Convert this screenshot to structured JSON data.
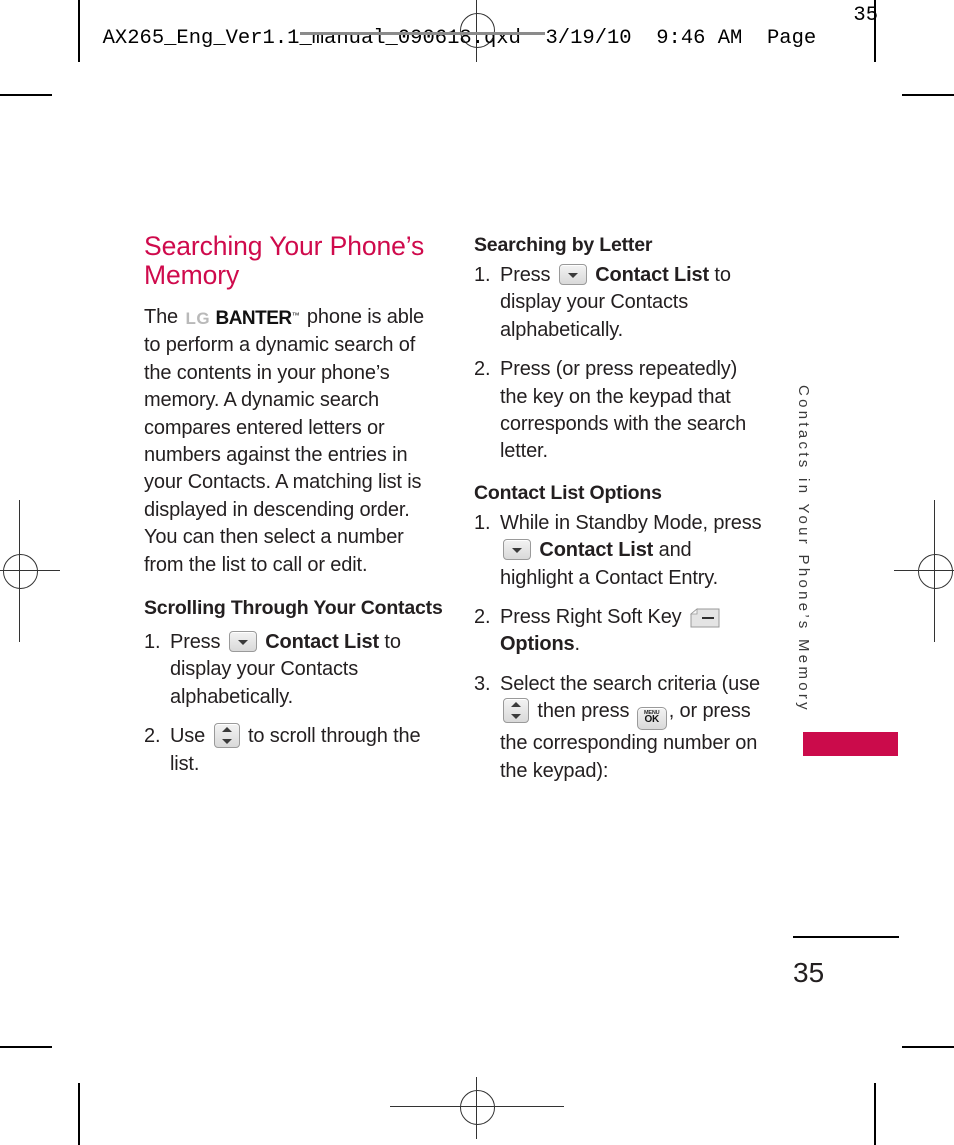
{
  "slug": {
    "filename": "AX265_Eng_Ver1.1_manual_090618.qxd",
    "date": "3/19/10",
    "time": "9:46 AM",
    "page_label": "Page",
    "page_value": "35"
  },
  "left_column": {
    "heading": "Searching Your Phone’s Memory",
    "paragraph_before_logo": "The",
    "logo": {
      "lg": "LG",
      "banter": "BANTER",
      "tm": "™"
    },
    "paragraph_after_logo": "phone is able to perform a dynamic search of the contents in your phone’s memory. A dynamic search compares entered letters or numbers against the entries in your Contacts. A matching list is displayed in descending order. You can then select a number from the list to call or edit.",
    "subheading": "Scrolling Through Your Contacts",
    "steps": [
      {
        "num": "1.",
        "before": "Press",
        "icon": "down-key-icon",
        "bold": "Contact List",
        "after": "to display your Contacts alphabetically."
      },
      {
        "num": "2.",
        "before": "Use",
        "icon": "scroll-key-icon",
        "bold": "",
        "after": "to scroll through the list."
      }
    ]
  },
  "right_column": {
    "heading_letter": "Searching by Letter",
    "letter_steps": [
      {
        "num": "1.",
        "before": "Press",
        "icon": "down-key-icon",
        "bold": "Contact List",
        "after": "to display your Contacts alphabetically."
      },
      {
        "num": "2.",
        "before": "Press (or press repeatedly) the key on the keypad that corresponds with the search letter.",
        "icon": "",
        "bold": "",
        "after": ""
      }
    ],
    "heading_options": "Contact List Options",
    "option_steps": [
      {
        "num": "1.",
        "before": "While in Standby Mode, press",
        "icon": "down-key-icon",
        "bold": "Contact List",
        "after": "and highlight a Contact Entry."
      },
      {
        "num": "2.",
        "before": "Press Right Soft Key",
        "icon": "right-soft-key-icon",
        "bold": "Options",
        "after": "."
      },
      {
        "num": "3.",
        "before": "Select the search criteria (use",
        "icon": "scroll-key-icon",
        "mid": "then press",
        "icon2": "menu-ok-key-icon",
        "after": ", or press the corresponding number on the keypad):"
      }
    ]
  },
  "side_tab": {
    "label": "Contacts in Your Phone’s Memory",
    "bar_color": "#cb0b4b"
  },
  "footer": {
    "page_number": "35"
  },
  "keys": {
    "menu_ok": {
      "menu": "MENU",
      "ok": "OK"
    }
  },
  "colors": {
    "heading": "#cf0a4c",
    "tab": "#cb0b4b",
    "text": "#231f20"
  }
}
